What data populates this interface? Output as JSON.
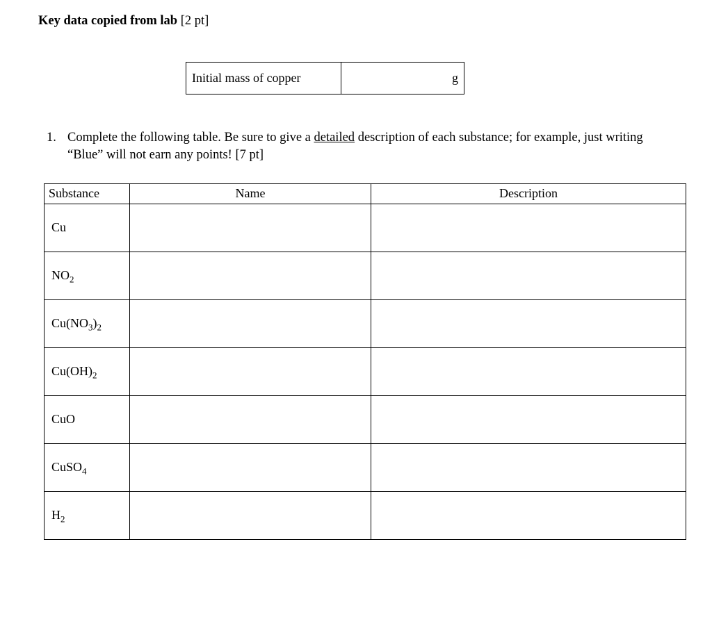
{
  "heading": {
    "bold": "Key data copied from lab",
    "points": " [2 pt]"
  },
  "mass": {
    "label": "Initial mass of copper",
    "unit": "g",
    "value": ""
  },
  "question": {
    "number": "1.",
    "text_a": "Complete the following table. Be sure to give a ",
    "text_detailed": "detailed",
    "text_b": " description of each substance; for example, just writing “Blue” will not earn any points! [7 pt]"
  },
  "table": {
    "headers": {
      "substance": "Substance",
      "name": "Name",
      "description": "Description"
    },
    "rows": [
      {
        "formula_html": "Cu",
        "name": "",
        "description": ""
      },
      {
        "formula_html": "NO<sub>2</sub>",
        "name": "",
        "description": ""
      },
      {
        "formula_html": "Cu(NO<sub>3</sub>)<sub>2</sub>",
        "name": "",
        "description": ""
      },
      {
        "formula_html": "Cu(OH)<sub>2</sub>",
        "name": "",
        "description": ""
      },
      {
        "formula_html": "CuO",
        "name": "",
        "description": ""
      },
      {
        "formula_html": "CuSO<sub>4</sub>",
        "name": "",
        "description": ""
      },
      {
        "formula_html": "H<sub>2</sub>",
        "name": "",
        "description": ""
      }
    ]
  }
}
